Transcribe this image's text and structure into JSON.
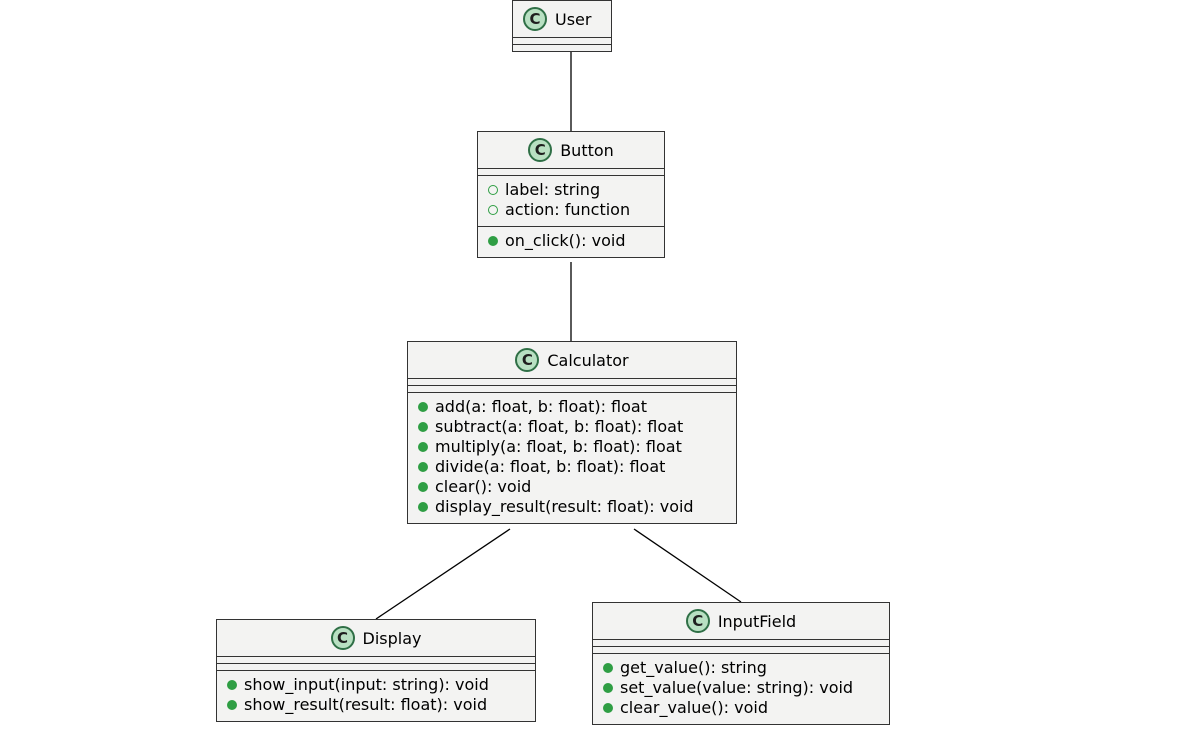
{
  "stereotype_letter": "C",
  "classes": {
    "user": {
      "name": "User",
      "attributes": [],
      "operations": []
    },
    "button": {
      "name": "Button",
      "attributes": [
        {
          "vis": "package",
          "text": "label: string"
        },
        {
          "vis": "package",
          "text": "action: function"
        }
      ],
      "operations": [
        {
          "vis": "public",
          "text": "on_click(): void"
        }
      ]
    },
    "calculator": {
      "name": "Calculator",
      "attributes": [],
      "operations": [
        {
          "vis": "public",
          "text": "add(a: float, b: float): float"
        },
        {
          "vis": "public",
          "text": "subtract(a: float, b: float): float"
        },
        {
          "vis": "public",
          "text": "multiply(a: float, b: float): float"
        },
        {
          "vis": "public",
          "text": "divide(a: float, b: float): float"
        },
        {
          "vis": "public",
          "text": "clear(): void"
        },
        {
          "vis": "public",
          "text": "display_result(result: float): void"
        }
      ]
    },
    "display": {
      "name": "Display",
      "attributes": [],
      "operations": [
        {
          "vis": "public",
          "text": "show_input(input: string): void"
        },
        {
          "vis": "public",
          "text": "show_result(result: float): void"
        }
      ]
    },
    "inputfield": {
      "name": "InputField",
      "attributes": [],
      "operations": [
        {
          "vis": "public",
          "text": "get_value(): string"
        },
        {
          "vis": "public",
          "text": "set_value(value: string): void"
        },
        {
          "vis": "public",
          "text": "clear_value(): void"
        }
      ]
    }
  },
  "edges": [
    {
      "from": "user",
      "to": "button"
    },
    {
      "from": "button",
      "to": "calculator"
    },
    {
      "from": "calculator",
      "to": "display"
    },
    {
      "from": "calculator",
      "to": "inputfield"
    }
  ]
}
